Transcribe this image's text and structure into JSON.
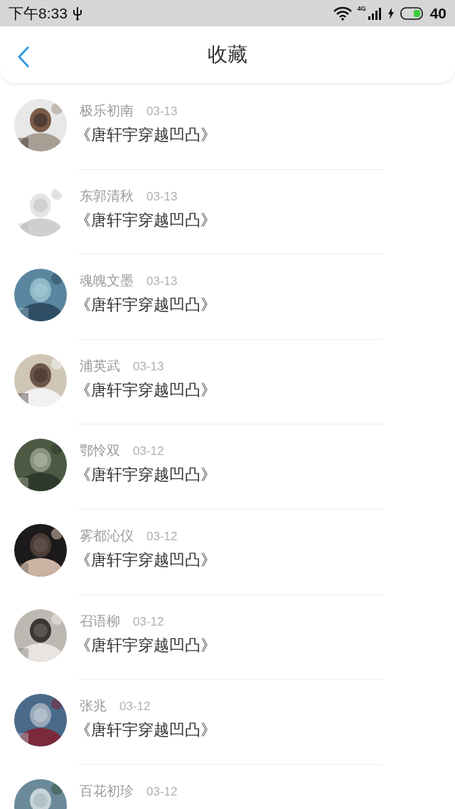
{
  "status_bar": {
    "time": "下午8:33",
    "network": "4G",
    "battery": "40"
  },
  "header": {
    "title": "收藏"
  },
  "favorites": [
    {
      "name": "极乐初南",
      "date": "03-13",
      "title": "《唐轩宇穿越凹凸》"
    },
    {
      "name": "东郭清秋",
      "date": "03-13",
      "title": "《唐轩宇穿越凹凸》"
    },
    {
      "name": "魂魄文墨",
      "date": "03-13",
      "title": "《唐轩宇穿越凹凸》"
    },
    {
      "name": "浦英武",
      "date": "03-13",
      "title": "《唐轩宇穿越凹凸》"
    },
    {
      "name": "鄂怜双",
      "date": "03-12",
      "title": "《唐轩宇穿越凹凸》"
    },
    {
      "name": "雾都沁仪",
      "date": "03-12",
      "title": "《唐轩宇穿越凹凸》"
    },
    {
      "name": "召语柳",
      "date": "03-12",
      "title": "《唐轩宇穿越凹凸》"
    },
    {
      "name": "张兆",
      "date": "03-12",
      "title": "《唐轩宇穿越凹凸》"
    },
    {
      "name": "百花初珍",
      "date": "03-12"
    }
  ]
}
